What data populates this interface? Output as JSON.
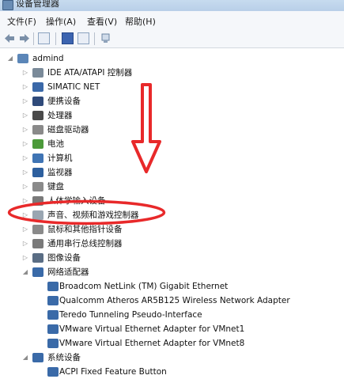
{
  "window": {
    "title": "设备管理器"
  },
  "menu": [
    "文件(F)",
    "操作(A)",
    "查看(V)",
    "帮助(H)"
  ],
  "toolbar": [
    "back-icon",
    "forward-icon",
    "properties-icon",
    "help-icon",
    "view-icon",
    "scan-icon"
  ],
  "tree": [
    {
      "label": "admind",
      "level": 0,
      "expand": "open",
      "icon": "computer-icon",
      "color": "#5b86b8"
    },
    {
      "label": "IDE ATA/ATAPI 控制器",
      "level": 1,
      "expand": "closed",
      "icon": "ide-controller-icon",
      "color": "#7a8a99"
    },
    {
      "label": "SIMATIC NET",
      "level": 1,
      "expand": "closed",
      "icon": "network-icon",
      "color": "#3a68a8"
    },
    {
      "label": "便携设备",
      "level": 1,
      "expand": "closed",
      "icon": "portable-device-icon",
      "color": "#2f4a7a"
    },
    {
      "label": "处理器",
      "level": 1,
      "expand": "closed",
      "icon": "processor-icon",
      "color": "#4a4a4a"
    },
    {
      "label": "磁盘驱动器",
      "level": 1,
      "expand": "closed",
      "icon": "disk-icon",
      "color": "#8a8a8a"
    },
    {
      "label": "电池",
      "level": 1,
      "expand": "closed",
      "icon": "battery-icon",
      "color": "#4c9a3a"
    },
    {
      "label": "计算机",
      "level": 1,
      "expand": "closed",
      "icon": "computer-icon",
      "color": "#3f74b4"
    },
    {
      "label": "监视器",
      "level": 1,
      "expand": "closed",
      "icon": "monitor-icon",
      "color": "#2d5f9e"
    },
    {
      "label": "键盘",
      "level": 1,
      "expand": "closed",
      "icon": "keyboard-icon",
      "color": "#8a8a8a"
    },
    {
      "label": "人体学输入设备",
      "level": 1,
      "expand": "closed",
      "icon": "hid-icon",
      "color": "#7a7a7a"
    },
    {
      "label": "声音、视频和游戏控制器",
      "level": 1,
      "expand": "closed",
      "icon": "speaker-icon",
      "color": "#9aa6b2"
    },
    {
      "label": "鼠标和其他指针设备",
      "level": 1,
      "expand": "closed",
      "icon": "mouse-icon",
      "color": "#8a8a8a"
    },
    {
      "label": "通用串行总线控制器",
      "level": 1,
      "expand": "closed",
      "icon": "usb-icon",
      "color": "#7a7a7a"
    },
    {
      "label": "图像设备",
      "level": 1,
      "expand": "closed",
      "icon": "camera-icon",
      "color": "#5a6d84"
    },
    {
      "label": "网络适配器",
      "level": 1,
      "expand": "open",
      "icon": "network-adapter-icon",
      "color": "#3a6aa8"
    },
    {
      "label": "Broadcom NetLink (TM) Gigabit Ethernet",
      "level": 2,
      "expand": "none",
      "icon": "network-adapter-icon",
      "color": "#3a6aa8"
    },
    {
      "label": "Qualcomm Atheros AR5B125 Wireless Network Adapter",
      "level": 2,
      "expand": "none",
      "icon": "network-adapter-icon",
      "color": "#3a6aa8"
    },
    {
      "label": "Teredo Tunneling Pseudo-Interface",
      "level": 2,
      "expand": "none",
      "icon": "network-adapter-icon",
      "color": "#3a6aa8"
    },
    {
      "label": "VMware Virtual Ethernet Adapter for VMnet1",
      "level": 2,
      "expand": "none",
      "icon": "network-adapter-icon",
      "color": "#3a6aa8"
    },
    {
      "label": "VMware Virtual Ethernet Adapter for VMnet8",
      "level": 2,
      "expand": "none",
      "icon": "network-adapter-icon",
      "color": "#3a6aa8"
    },
    {
      "label": "系统设备",
      "level": 1,
      "expand": "open",
      "icon": "system-device-icon",
      "color": "#3a6aa8"
    },
    {
      "label": "ACPI Fixed Feature Button",
      "level": 2,
      "expand": "none",
      "icon": "system-device-icon",
      "color": "#3a6aa8"
    }
  ],
  "annotation": {
    "arrow_color": "#e8292a",
    "circle_color": "#e8292a"
  }
}
